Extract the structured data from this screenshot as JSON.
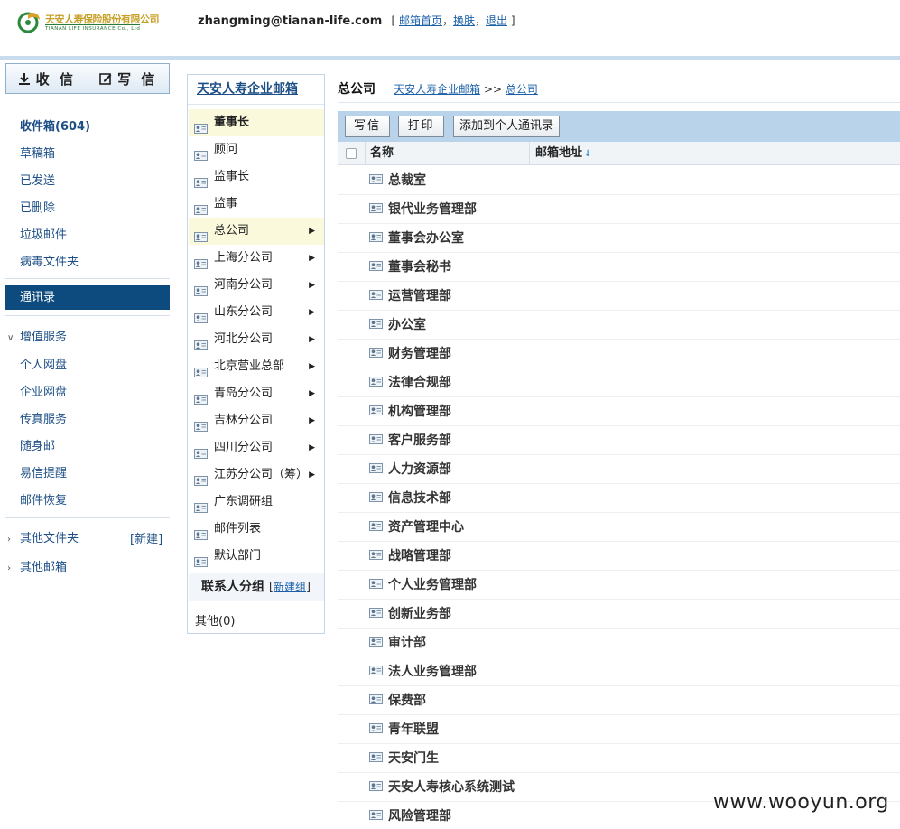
{
  "header": {
    "logo_cn": "天安人寿保险股份有限公司",
    "logo_en": "TIANAN LIFE INSURANCE Co., Ltd",
    "email": "zhangming@tianan-life.com",
    "links": [
      "邮箱首页",
      "换肤",
      "退出"
    ]
  },
  "nav": {
    "receive": "收 信",
    "compose": "写 信",
    "folders": [
      "收件箱(604)",
      "草稿箱",
      "已发送",
      "已删除",
      "垃圾邮件",
      "病毒文件夹"
    ],
    "contacts": "通讯录",
    "value_added": "增值服务",
    "services": [
      "个人网盘",
      "企业网盘",
      "传真服务",
      "随身邮",
      "易信提醒",
      "邮件恢复"
    ],
    "other_folders": "其他文件夹",
    "new_label": "[新建]",
    "other_mailboxes": "其他邮箱"
  },
  "tree": {
    "title": "天安人寿企业邮箱",
    "items": [
      {
        "label": "董事长",
        "expandable": false
      },
      {
        "label": "顾问",
        "expandable": false
      },
      {
        "label": "监事长",
        "expandable": false
      },
      {
        "label": "监事",
        "expandable": false
      },
      {
        "label": "总公司",
        "expandable": true
      },
      {
        "label": "上海分公司",
        "expandable": true
      },
      {
        "label": "河南分公司",
        "expandable": true
      },
      {
        "label": "山东分公司",
        "expandable": true
      },
      {
        "label": "河北分公司",
        "expandable": true
      },
      {
        "label": "北京营业总部",
        "expandable": true
      },
      {
        "label": "青岛分公司",
        "expandable": true
      },
      {
        "label": "吉林分公司",
        "expandable": true
      },
      {
        "label": "四川分公司",
        "expandable": true
      },
      {
        "label": "江苏分公司（筹）",
        "expandable": true
      },
      {
        "label": "广东调研组",
        "expandable": false
      },
      {
        "label": "邮件列表",
        "expandable": false
      },
      {
        "label": "默认部门",
        "expandable": false
      }
    ],
    "groups_label": "联系人分组",
    "new_group": "新建组",
    "other_group": "其他(0)"
  },
  "content": {
    "current": "总公司",
    "path_root": "天安人寿企业邮箱",
    "path_sep": ">>",
    "path_current": "总公司",
    "toolbar": [
      "写信",
      "打印",
      "添加到个人通讯录"
    ],
    "col_name": "名称",
    "col_email": "邮箱地址",
    "sort_icon": "↓",
    "rows": [
      "总裁室",
      "银代业务管理部",
      "董事会办公室",
      "董事会秘书",
      "运营管理部",
      "办公室",
      "财务管理部",
      "法律合规部",
      "机构管理部",
      "客户服务部",
      "人力资源部",
      "信息技术部",
      "资产管理中心",
      "战略管理部",
      "个人业务管理部",
      "创新业务部",
      "审计部",
      "法人业务管理部",
      "保费部",
      "青年联盟",
      "天安门生",
      "天安人寿核心系统测试",
      "风险管理部"
    ]
  },
  "watermark": "www.wooyun.org"
}
